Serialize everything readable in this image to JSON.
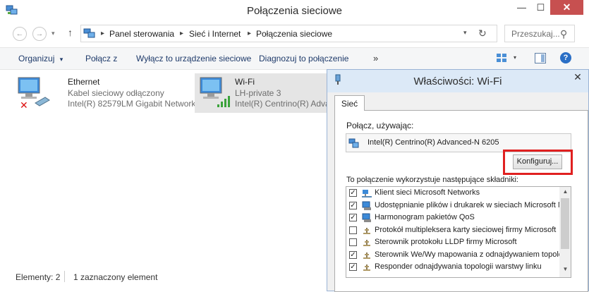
{
  "window": {
    "title": "Połączenia sieciowe",
    "minimize": "—",
    "maximize": "☐",
    "close": "✕"
  },
  "nav": {
    "back": "←",
    "forward": "→",
    "history": "▾",
    "up": "↑"
  },
  "address": {
    "crumbs": [
      "Panel sterowania",
      "Sieć i Internet",
      "Połączenia sieciowe"
    ],
    "separator": "▸",
    "dropdown": "▾",
    "refresh": "↻"
  },
  "search": {
    "placeholder": "Przeszukaj...",
    "icon": "⚲"
  },
  "commands": {
    "items": [
      "Organizuj",
      "Połącz z",
      "Wyłącz to urządzenie sieciowe",
      "Diagnozuj to połączenie"
    ],
    "organize_arrow": "▾",
    "more": "»",
    "view_drop": "▾",
    "help": "?"
  },
  "connections": [
    {
      "name": "Ethernet",
      "status": "Kabel sieciowy odłączony",
      "device": "Intel(R) 82579LM Gigabit Network..."
    },
    {
      "name": "Wi-Fi",
      "status": "LH-private  3",
      "device": "Intel(R) Centrino(R) Adva"
    }
  ],
  "statusbar": {
    "count": "Elementy: 2",
    "selected": "1 zaznaczony element"
  },
  "dialog": {
    "title": "Właściwości: Wi-Fi",
    "close": "✕",
    "tab": "Sieć",
    "connect_using": "Połącz, używając:",
    "adapter": "Intel(R) Centrino(R) Advanced-N 6205",
    "configure": "Konfiguruj...",
    "components_label": "To połączenie wykorzystuje następujące składniki:",
    "components": [
      {
        "label": "Klient sieci Microsoft Networks",
        "checked": true,
        "icon": "network-client-icon"
      },
      {
        "label": "Udostępnianie plików i drukarek w sieciach Microsoft N",
        "checked": true,
        "icon": "file-share-icon"
      },
      {
        "label": "Harmonogram pakietów QoS",
        "checked": true,
        "icon": "qos-icon"
      },
      {
        "label": "Protokół multipleksera karty sieciowej firmy Microsoft",
        "checked": false,
        "icon": "protocol-icon"
      },
      {
        "label": "Sterownik protokołu LLDP firmy Microsoft",
        "checked": false,
        "icon": "protocol-icon"
      },
      {
        "label": "Sterownik We/Wy mapowania z odnajdywaniem topolo",
        "checked": true,
        "icon": "protocol-icon"
      },
      {
        "label": "Responder odnajdywania topologii warstwy linku",
        "checked": true,
        "icon": "protocol-icon"
      }
    ],
    "scroll_up": "▲",
    "scroll_down": "▼"
  },
  "colors": {
    "command_text": "#1e3a6a",
    "highlight": "#e02020",
    "close_button": "#c75050"
  }
}
